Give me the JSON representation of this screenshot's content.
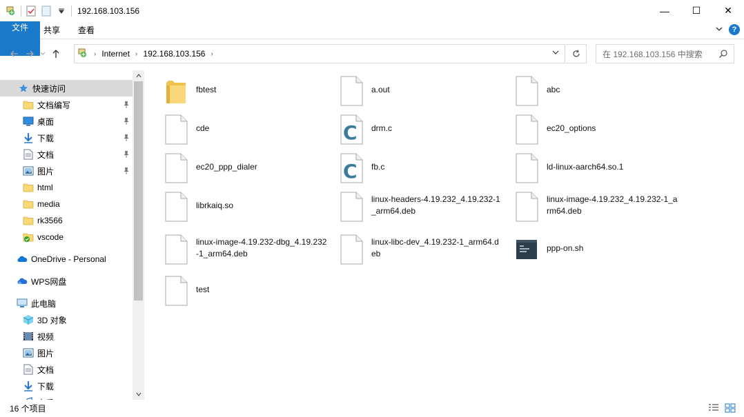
{
  "window": {
    "title": "192.168.103.156",
    "minimize": "—",
    "maximize": "☐",
    "close": "✕"
  },
  "ribbon": {
    "tabs": [
      "文件",
      "主页",
      "共享",
      "查看"
    ]
  },
  "address": {
    "crumbs": [
      "Internet",
      "192.168.103.156"
    ],
    "search_placeholder": "在 192.168.103.156 中搜索"
  },
  "nav": {
    "quick_access": "快速访问",
    "items": [
      {
        "label": "文档编写",
        "icon": "folder-icon",
        "pinned": true
      },
      {
        "label": "桌面",
        "icon": "desktop-icon",
        "pinned": true
      },
      {
        "label": "下载",
        "icon": "download-icon",
        "pinned": true
      },
      {
        "label": "文档",
        "icon": "document-icon",
        "pinned": true
      },
      {
        "label": "图片",
        "icon": "picture-icon",
        "pinned": true
      },
      {
        "label": "html",
        "icon": "folder-icon",
        "pinned": false
      },
      {
        "label": "media",
        "icon": "folder-icon",
        "pinned": false
      },
      {
        "label": "rk3566",
        "icon": "folder-icon",
        "pinned": false
      },
      {
        "label": "vscode",
        "icon": "vscode-folder-icon",
        "pinned": false
      }
    ],
    "onedrive": "OneDrive - Personal",
    "wps": "WPS网盘",
    "this_pc": "此电脑",
    "pc_items": [
      {
        "label": "3D 对象",
        "icon": "3d-objects-icon"
      },
      {
        "label": "视频",
        "icon": "video-icon"
      },
      {
        "label": "图片",
        "icon": "picture-icon"
      },
      {
        "label": "文档",
        "icon": "document-icon"
      },
      {
        "label": "下载",
        "icon": "download-icon"
      },
      {
        "label": "音乐",
        "icon": "music-icon"
      }
    ]
  },
  "files": [
    {
      "name": "fbtest",
      "type": "folder"
    },
    {
      "name": "a.out",
      "type": "file"
    },
    {
      "name": "abc",
      "type": "file"
    },
    {
      "name": "cde",
      "type": "file"
    },
    {
      "name": "drm.c",
      "type": "c"
    },
    {
      "name": "ec20_options",
      "type": "file"
    },
    {
      "name": "ec20_ppp_dialer",
      "type": "file"
    },
    {
      "name": "fb.c",
      "type": "c"
    },
    {
      "name": "ld-linux-aarch64.so.1",
      "type": "file"
    },
    {
      "name": "librkaiq.so",
      "type": "file"
    },
    {
      "name": "linux-headers-4.19.232_4.19.232-1_arm64.deb",
      "type": "file"
    },
    {
      "name": "linux-image-4.19.232_4.19.232-1_arm64.deb",
      "type": "file"
    },
    {
      "name": "linux-image-4.19.232-dbg_4.19.232-1_arm64.deb",
      "type": "file"
    },
    {
      "name": "linux-libc-dev_4.19.232-1_arm64.deb",
      "type": "file"
    },
    {
      "name": "ppp-on.sh",
      "type": "shell"
    },
    {
      "name": "test",
      "type": "file"
    }
  ],
  "status": {
    "count": "16 个项目"
  },
  "colors": {
    "accent": "#1979ca",
    "folder": "#f8d775",
    "selected": "#d9d9d9"
  }
}
